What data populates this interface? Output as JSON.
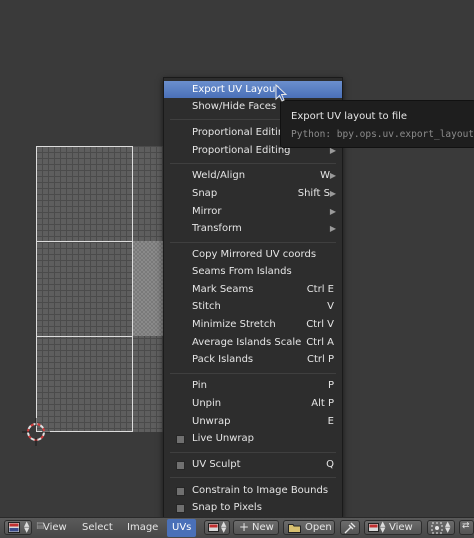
{
  "menu": {
    "items": [
      {
        "label": "Export UV Layout",
        "shortcut": "",
        "submenu": false
      },
      {
        "label": "Show/Hide Faces",
        "shortcut": "",
        "submenu": true
      },
      {
        "label": "Proportional Editing",
        "shortcut": "",
        "submenu": true
      },
      {
        "label": "Proportional Editing",
        "shortcut": "",
        "submenu": true
      },
      {
        "label": "Weld/Align",
        "shortcut": "W",
        "submenu": true
      },
      {
        "label": "Snap",
        "shortcut": "Shift S",
        "submenu": true
      },
      {
        "label": "Mirror",
        "shortcut": "",
        "submenu": true
      },
      {
        "label": "Transform",
        "shortcut": "",
        "submenu": true
      },
      {
        "label": "Copy Mirrored UV coords",
        "shortcut": "",
        "submenu": false
      },
      {
        "label": "Seams From Islands",
        "shortcut": "",
        "submenu": false
      },
      {
        "label": "Mark Seams",
        "shortcut": "Ctrl E",
        "submenu": false
      },
      {
        "label": "Stitch",
        "shortcut": "V",
        "submenu": false
      },
      {
        "label": "Minimize Stretch",
        "shortcut": "Ctrl V",
        "submenu": false
      },
      {
        "label": "Average Islands Scale",
        "shortcut": "Ctrl A",
        "submenu": false
      },
      {
        "label": "Pack Islands",
        "shortcut": "Ctrl P",
        "submenu": false
      },
      {
        "label": "Pin",
        "shortcut": "P",
        "submenu": false
      },
      {
        "label": "Unpin",
        "shortcut": "Alt P",
        "submenu": false
      },
      {
        "label": "Unwrap",
        "shortcut": "E",
        "submenu": false
      },
      {
        "label": "Live Unwrap",
        "shortcut": "",
        "checkbox": true,
        "checked": false
      },
      {
        "label": "UV Sculpt",
        "shortcut": "Q",
        "checkbox": true,
        "checked": false
      },
      {
        "label": "Constrain to Image Bounds",
        "shortcut": "",
        "checkbox": true,
        "checked": false
      },
      {
        "label": "Snap to Pixels",
        "shortcut": "",
        "checkbox": true,
        "checked": false
      }
    ],
    "highlighted": "Export UV Layout"
  },
  "tooltip": {
    "description": "Export UV layout to file",
    "python": "Python: bpy.ops.uv.export_layout()"
  },
  "header": {
    "view": "View",
    "select": "Select",
    "image": "Image",
    "uvs": "UVs",
    "new": "New",
    "open": "Open",
    "view2": "View"
  },
  "colors": {
    "highlight": "#5a7fc4",
    "menu_bg": "#2d2d2d",
    "background": "#393939"
  }
}
